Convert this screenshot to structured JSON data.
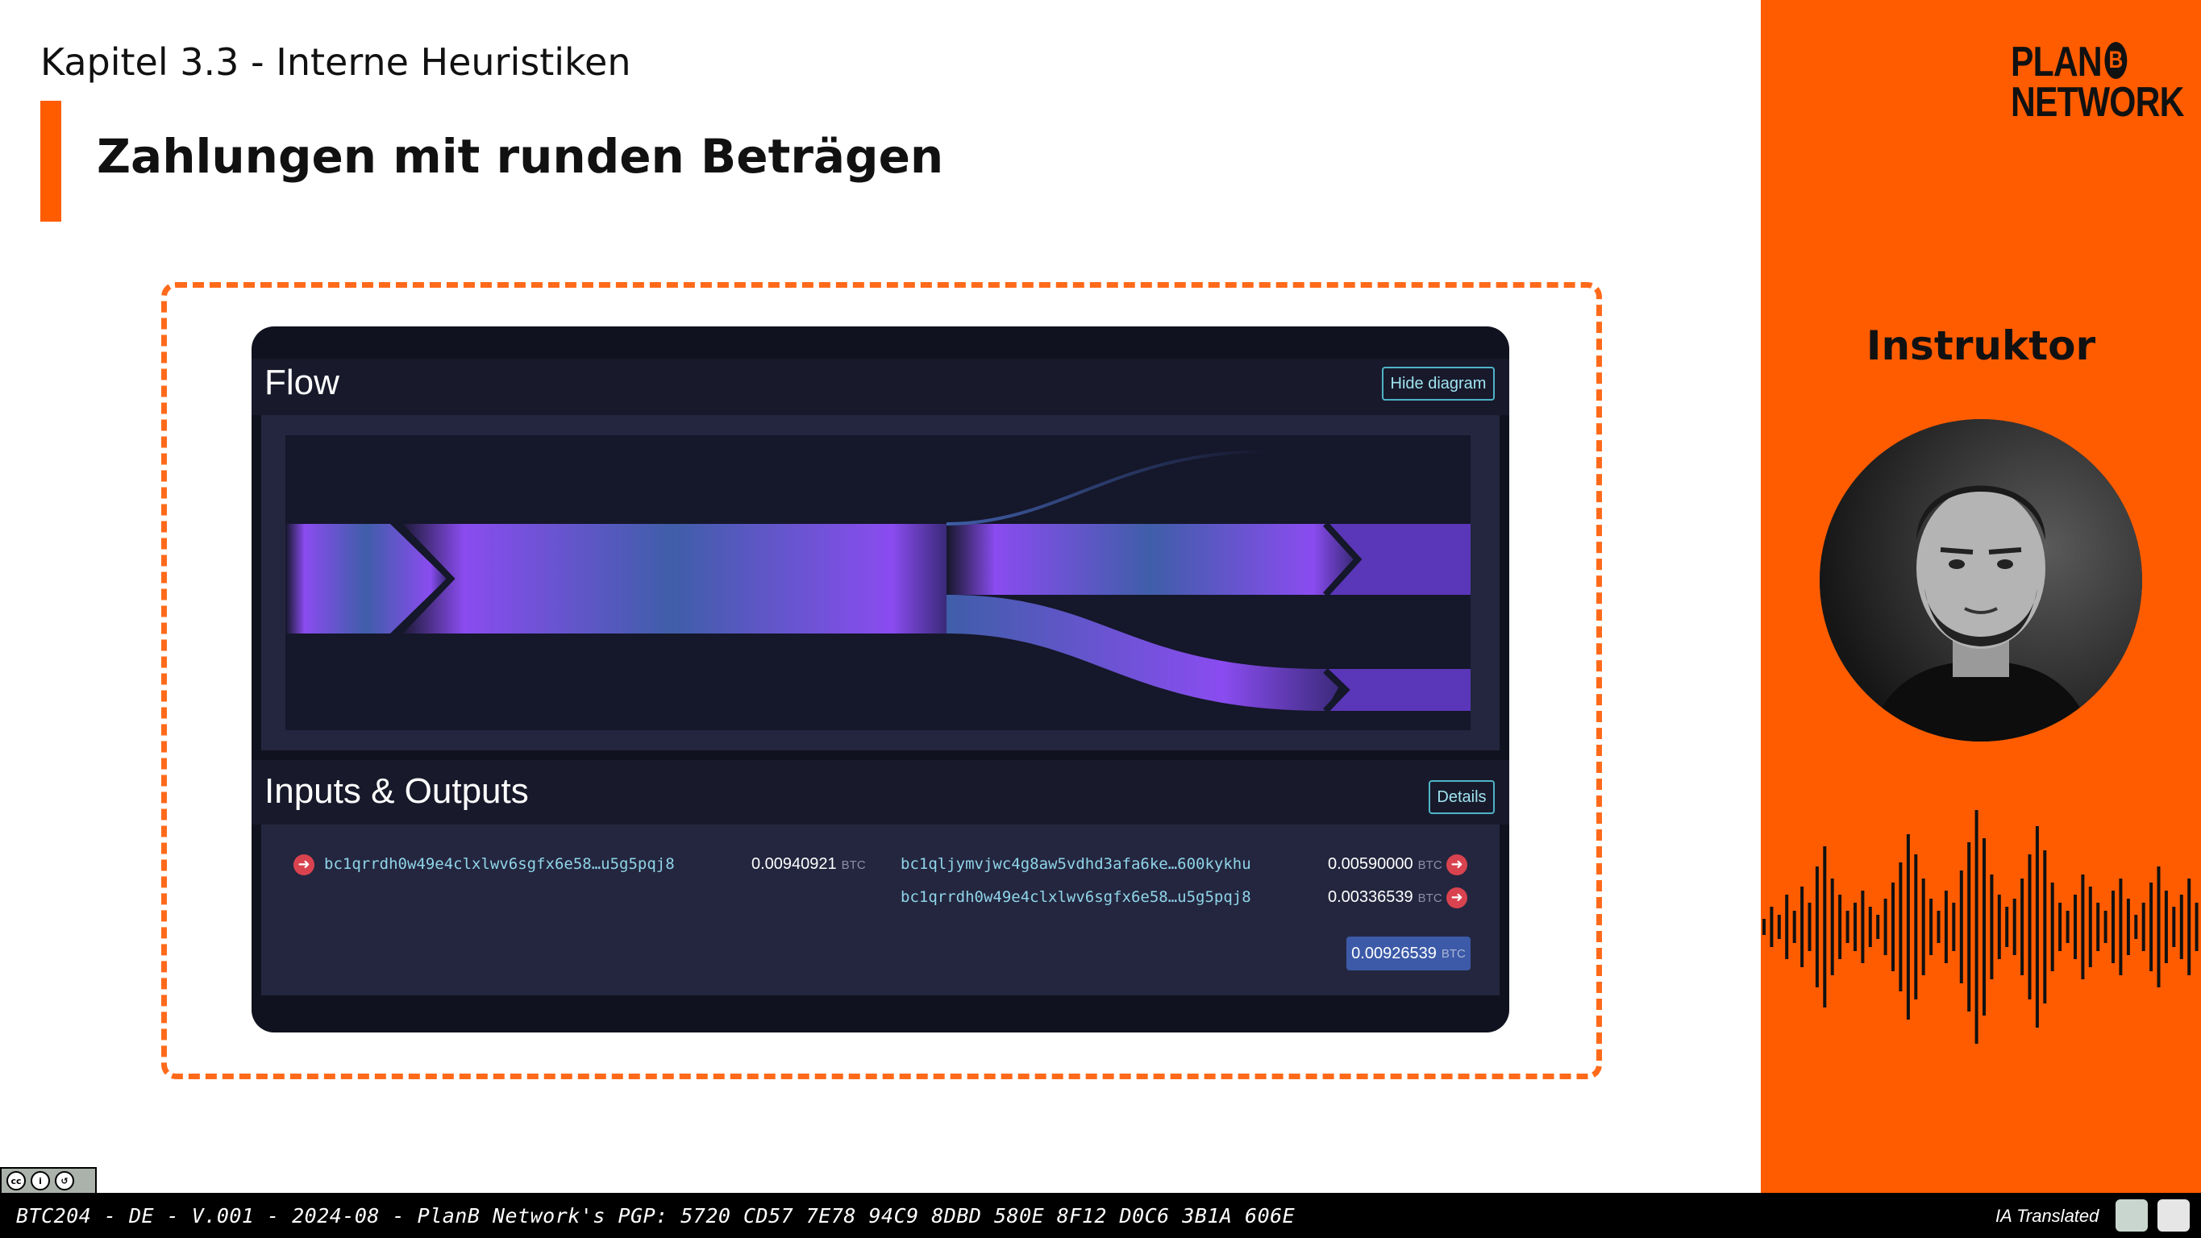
{
  "slide": {
    "chapter": "Kapitel 3.3 - Interne Heuristiken",
    "title": "Zahlungen mit runden Beträgen"
  },
  "screenshot": {
    "flow_title": "Flow",
    "hide_diagram_label": "Hide diagram",
    "io_title": "Inputs & Outputs",
    "details_label": "Details",
    "inputs": [
      {
        "address": "bc1qrrdh0w49e4clxlwv6sgfx6e58…u5g5pqj8",
        "amount": "0.00940921",
        "unit": "BTC",
        "icon": "arrow-right-circle-icon"
      }
    ],
    "outputs": [
      {
        "address": "bc1qljymvjwc4g8aw5vdhd3afa6ke…600kykhu",
        "amount": "0.00590000",
        "unit": "BTC",
        "icon": "arrow-right-circle-icon"
      },
      {
        "address": "bc1qrrdh0w49e4clxlwv6sgfx6e58…u5g5pqj8",
        "amount": "0.00336539",
        "unit": "BTC",
        "icon": "arrow-right-circle-icon"
      }
    ],
    "total": {
      "amount": "0.00926539",
      "unit": "BTC"
    }
  },
  "sidebar": {
    "logo_line1": "PLAN",
    "logo_b": "B",
    "logo_line2": "NETWORK",
    "instructor_label": "Instruktor"
  },
  "footer": {
    "text": "BTC204 - DE - V.001 - 2024-08 - PlanB Network's PGP: 5720 CD57 7E78 94C9 8DBD 580E 8F12 D0C6 3B1A 606E",
    "ia_label": "IA Translated",
    "license": "cc"
  },
  "colors": {
    "accent": "#ff5c00",
    "flow_purple": "#8a4cf0",
    "flow_blue": "#3f5ea8",
    "link_cyan": "#8fd4e8",
    "arrow_red": "#d9434f"
  }
}
